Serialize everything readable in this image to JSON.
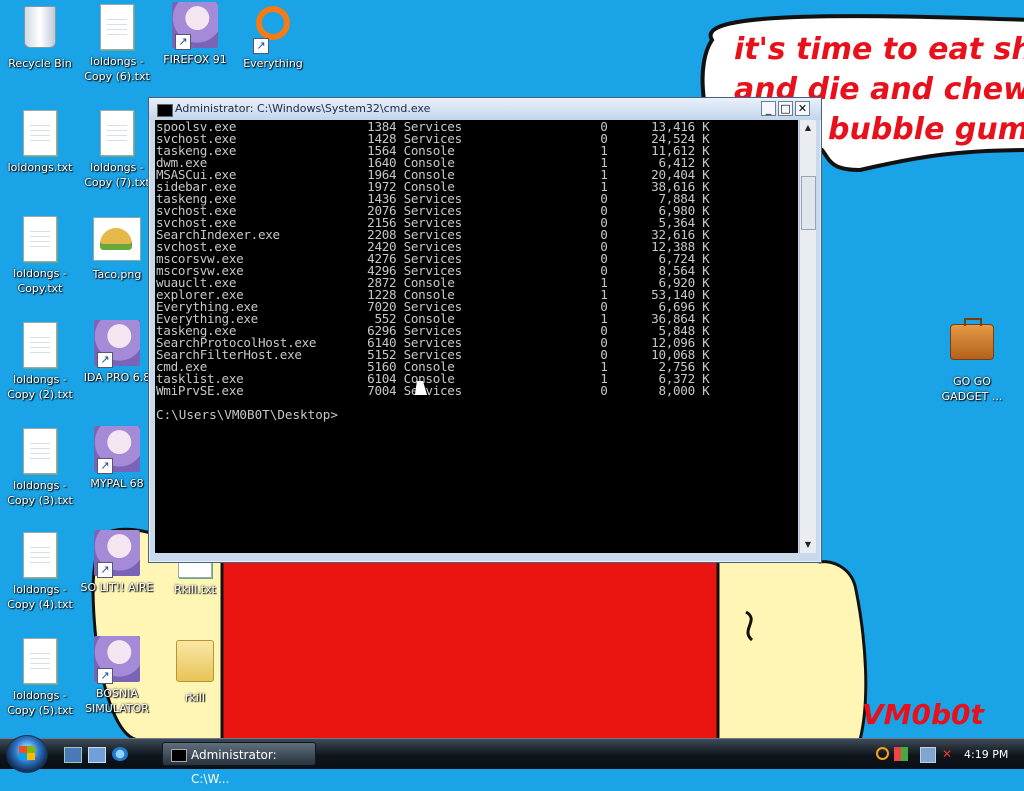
{
  "wallpaper": {
    "speech_text": "it's time to eat shit\nand die and chew\n         bubble gum",
    "signature": "VM0b0t",
    "accent_color": "#e8101a",
    "background_color": "#1aa3e6"
  },
  "desktop_icons": [
    {
      "label": "Recycle Bin",
      "icon": "recycle-bin-icon"
    },
    {
      "label": "loldongs - Copy (6).txt",
      "icon": "text-file-icon"
    },
    {
      "label": "FIREFOX 91",
      "icon": "anime-girl-icon"
    },
    {
      "label": "Everything",
      "icon": "everything-search-icon"
    },
    {
      "label": "loldongs.txt",
      "icon": "text-file-icon"
    },
    {
      "label": "loldongs - Copy (7).txt",
      "icon": "text-file-icon"
    },
    {
      "label": "loldongs - Copy.txt",
      "icon": "text-file-icon"
    },
    {
      "label": "Taco.png",
      "icon": "taco-image-icon"
    },
    {
      "label": "loldongs - Copy (2).txt",
      "icon": "text-file-icon"
    },
    {
      "label": "IDA PRO 6.8",
      "icon": "anime-girl-icon"
    },
    {
      "label": "loldongs - Copy (3).txt",
      "icon": "text-file-icon"
    },
    {
      "label": "MYPAL 68",
      "icon": "anime-girl-icon"
    },
    {
      "label": "loldongs - Copy (4).txt",
      "icon": "text-file-icon"
    },
    {
      "label": "SO LIT!! AIRE",
      "icon": "anime-girl-icon"
    },
    {
      "label": "Rkill.txt",
      "icon": "text-file-icon"
    },
    {
      "label": "loldongs - Copy (5).txt",
      "icon": "text-file-icon"
    },
    {
      "label": "BOSNIA SIMULATOR",
      "icon": "anime-girl-icon"
    },
    {
      "label": "rkill",
      "icon": "folder-icon"
    },
    {
      "label": "GO GO GADGET ...",
      "icon": "briefcase-icon"
    }
  ],
  "cmd_window": {
    "title": "Administrator: C:\\Windows\\System32\\cmd.exe",
    "minimize_label": "_",
    "maximize_label": "□",
    "close_label": "✕",
    "rows": [
      [
        "spoolsv.exe",
        "1384",
        "Services",
        "0",
        "13,416 K"
      ],
      [
        "svchost.exe",
        "1428",
        "Services",
        "0",
        "24,524 K"
      ],
      [
        "taskeng.exe",
        "1564",
        "Console",
        "1",
        "11,612 K"
      ],
      [
        "dwm.exe",
        "1640",
        "Console",
        "1",
        "6,412 K"
      ],
      [
        "MSASCui.exe",
        "1964",
        "Console",
        "1",
        "20,404 K"
      ],
      [
        "sidebar.exe",
        "1972",
        "Console",
        "1",
        "38,616 K"
      ],
      [
        "taskeng.exe",
        "1436",
        "Services",
        "0",
        "7,884 K"
      ],
      [
        "svchost.exe",
        "2076",
        "Services",
        "0",
        "6,980 K"
      ],
      [
        "svchost.exe",
        "2156",
        "Services",
        "0",
        "5,364 K"
      ],
      [
        "SearchIndexer.exe",
        "2208",
        "Services",
        "0",
        "32,616 K"
      ],
      [
        "svchost.exe",
        "2420",
        "Services",
        "0",
        "12,388 K"
      ],
      [
        "mscorsvw.exe",
        "4276",
        "Services",
        "0",
        "6,724 K"
      ],
      [
        "mscorsvw.exe",
        "4296",
        "Services",
        "0",
        "8,564 K"
      ],
      [
        "wuauclt.exe",
        "2872",
        "Console",
        "1",
        "6,920 K"
      ],
      [
        "explorer.exe",
        "1228",
        "Console",
        "1",
        "53,140 K"
      ],
      [
        "Everything.exe",
        "7020",
        "Services",
        "0",
        "6,696 K"
      ],
      [
        "Everything.exe",
        "552",
        "Console",
        "1",
        "36,864 K"
      ],
      [
        "taskeng.exe",
        "6296",
        "Services",
        "0",
        "5,848 K"
      ],
      [
        "SearchProtocolHost.exe",
        "6140",
        "Services",
        "0",
        "12,096 K"
      ],
      [
        "SearchFilterHost.exe",
        "5152",
        "Services",
        "0",
        "10,068 K"
      ],
      [
        "cmd.exe",
        "5160",
        "Console",
        "1",
        "2,756 K"
      ],
      [
        "tasklist.exe",
        "6104",
        "Console",
        "1",
        "6,372 K"
      ],
      [
        "WmiPrvSE.exe",
        "7004",
        "Services",
        "0",
        "8,000 K"
      ]
    ],
    "prompt": "C:\\Users\\VM0B0T\\Desktop>"
  },
  "taskbar": {
    "start_label": "Start",
    "task_button_label": "Administrator: C:\\W...",
    "clock": "4:19 PM",
    "quick_launch": [
      "show-desktop-icon",
      "switch-windows-icon",
      "internet-explorer-icon"
    ],
    "tray_icons": [
      "search-icon",
      "network-icon",
      "volume-muted-icon"
    ]
  }
}
